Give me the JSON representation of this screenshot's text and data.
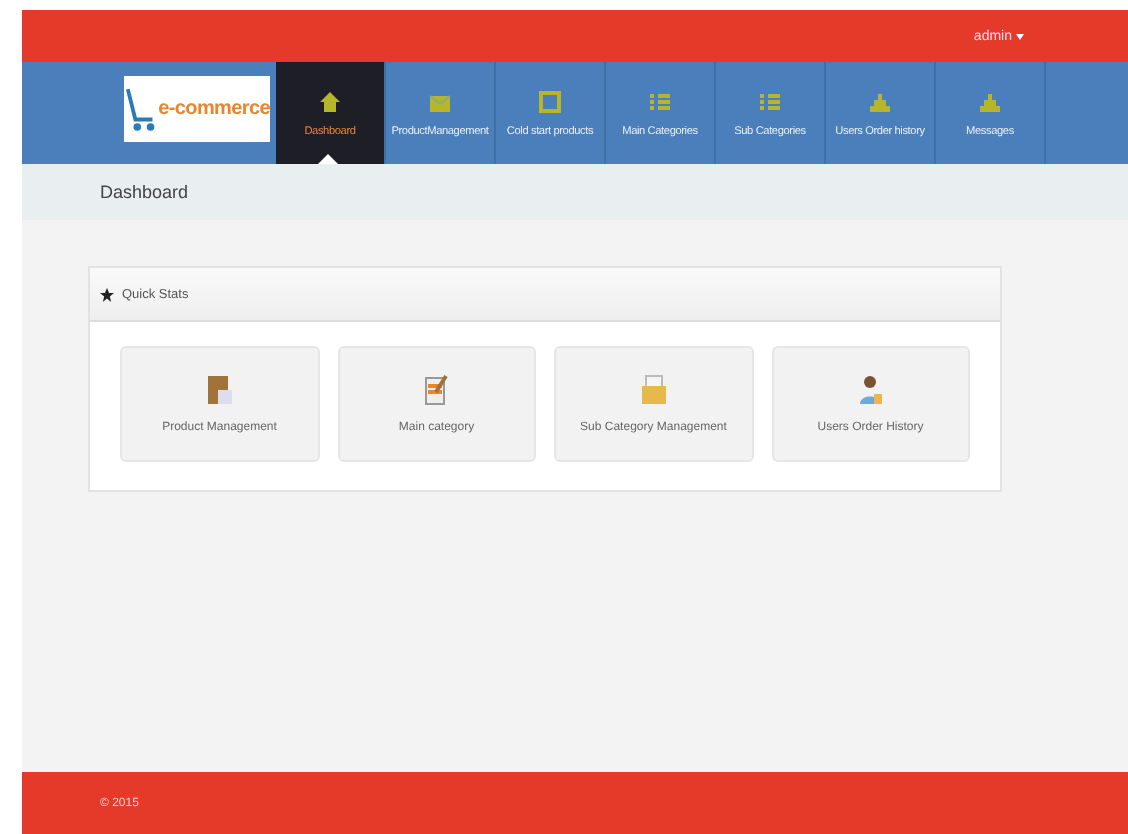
{
  "top_bar": {
    "user_menu": "admin"
  },
  "logo": {
    "text": "e-commerce"
  },
  "nav": [
    {
      "label": "Dashboard",
      "selected": true
    },
    {
      "label": "ProductManagement",
      "selected": false
    },
    {
      "label": "Cold start products",
      "selected": false
    },
    {
      "label": "Main Categories",
      "selected": false
    },
    {
      "label": "Sub Categories",
      "selected": false
    },
    {
      "label": "Users Order history",
      "selected": false
    },
    {
      "label": "Messages",
      "selected": false
    }
  ],
  "breadcrumb": "Dashboard",
  "panel": {
    "title": "Quick Stats",
    "tiles": [
      {
        "label": "Product Management"
      },
      {
        "label": "Main category"
      },
      {
        "label": "Sub Category Management"
      },
      {
        "label": "Users Order History"
      }
    ]
  },
  "footer": "© 2015"
}
